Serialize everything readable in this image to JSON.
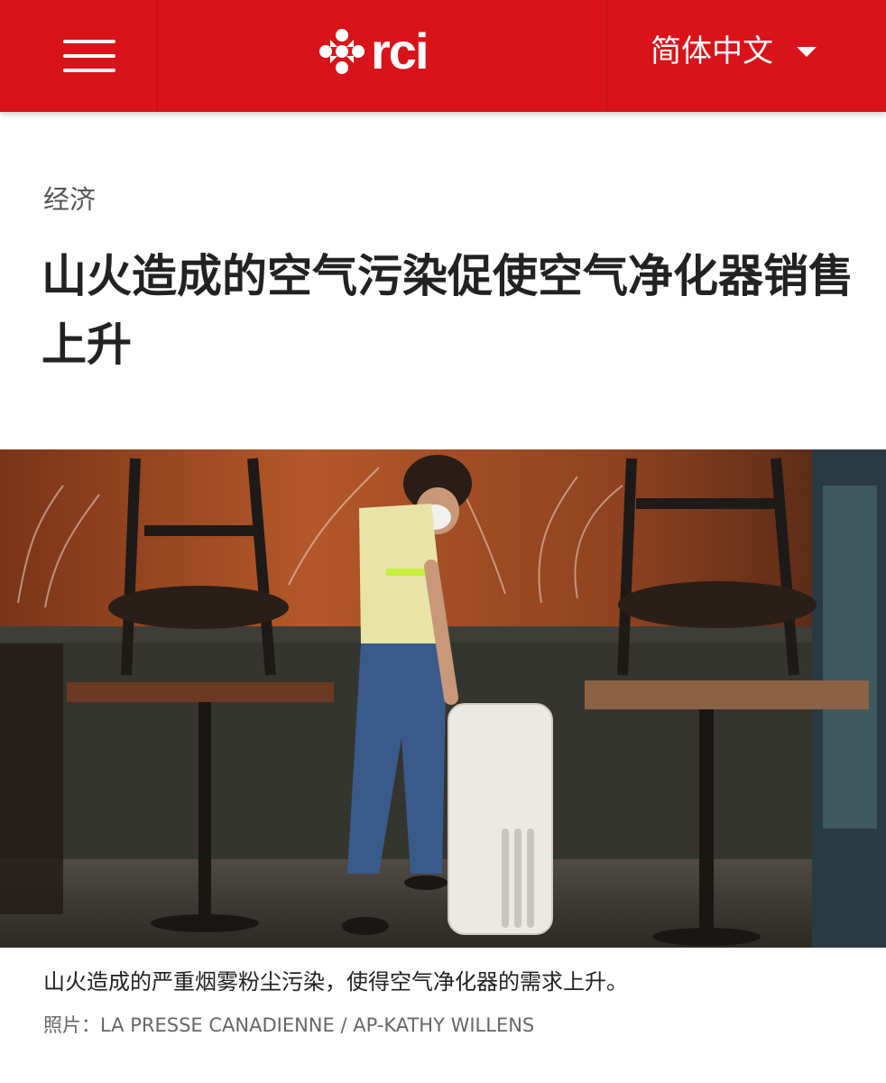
{
  "header": {
    "menu_icon": "hamburger-menu-icon",
    "logo": {
      "text": "rci",
      "icon": "cbc-gem-icon"
    },
    "language": {
      "selected": "简体中文",
      "icon": "caret-down-icon"
    },
    "colors": {
      "brand_red": "#d8131a",
      "text_on_brand": "#ffffff"
    }
  },
  "article": {
    "category": "经济",
    "title": "山火造成的空气污染促使空气净化器销售上升",
    "photo": {
      "caption": "山火造成的严重烟雾粉尘污染，使得空气净化器的需求上升。",
      "credit": "照片：LA PRESSE CANADIENNE / AP-KATHY WILLENS"
    }
  }
}
